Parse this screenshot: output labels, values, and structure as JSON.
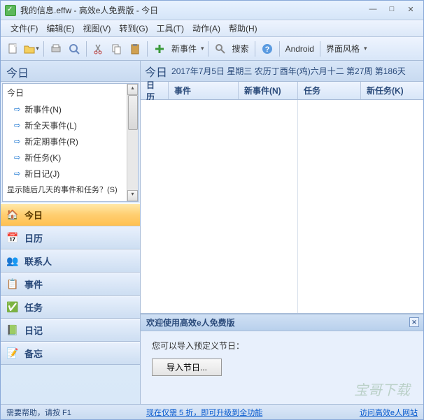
{
  "title": "我的信息.effw - 高效e人免费版 - 今日",
  "menus": [
    "文件(F)",
    "编辑(E)",
    "视图(V)",
    "转到(G)",
    "工具(T)",
    "动作(A)",
    "帮助(H)"
  ],
  "toolbar": {
    "new_event": "新事件",
    "search": "搜索",
    "android": "Android",
    "skin": "界面风格"
  },
  "sidebar": {
    "header": "今日",
    "tree_title": "今日",
    "items": [
      "新事件(N)",
      "新全天事件(L)",
      "新定期事件(R)",
      "新任务(K)",
      "新日记(J)"
    ],
    "cut_item": "显示随后几天的事件和任务？(S)"
  },
  "nav": [
    {
      "label": "今日",
      "icon": "🏠",
      "color": "#5a9a40"
    },
    {
      "label": "日历",
      "icon": "📅",
      "color": "#c05050"
    },
    {
      "label": "联系人",
      "icon": "👥",
      "color": "#3a7ac0"
    },
    {
      "label": "事件",
      "icon": "📋",
      "color": "#d08030"
    },
    {
      "label": "任务",
      "icon": "✓",
      "color": "#c04040"
    },
    {
      "label": "日记",
      "icon": "📗",
      "color": "#4a9a50"
    },
    {
      "label": "备忘",
      "icon": "📝",
      "color": "#d0b030"
    }
  ],
  "content": {
    "header_big": "今日",
    "header_date": "2017年7月5日 星期三 农历丁酉年(鸡)六月十二  第27周 第186天",
    "cols": {
      "calendar": "日历",
      "event": "事件",
      "new_event": "新事件(N)",
      "task": "任务",
      "new_task": "新任务(K)"
    }
  },
  "welcome": {
    "title": "欢迎使用高效e人免费版",
    "text": "您可以导入预定义节日：",
    "button": "导入节日..."
  },
  "status": {
    "help": "需要帮助，请按 F1",
    "promo": "现在仅需 5 折，即可升级到全功能",
    "link": "访问高效e人网站"
  },
  "watermark": "宝哥下载"
}
